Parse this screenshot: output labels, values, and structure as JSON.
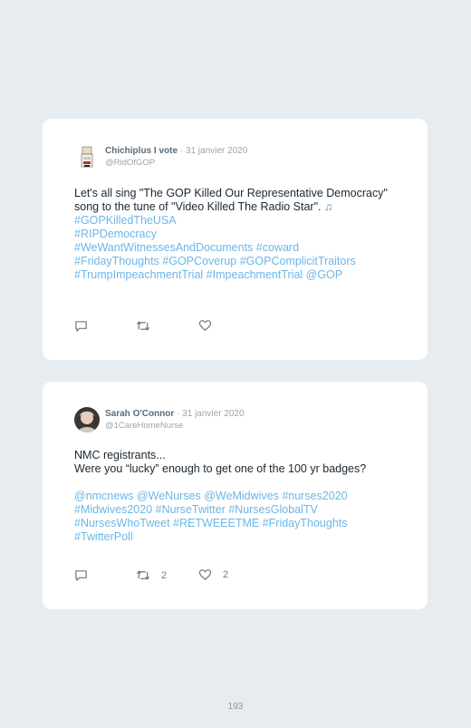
{
  "tweets": [
    {
      "author": "Chichiplus I vote",
      "date": "· 31 janvier 2020",
      "handle": "@RidOfGOP",
      "text": "Let's all sing \"The GOP Killed Our Representative Democracy\" song to the tune of \"Video Killed The Radio Star\".",
      "emoji_icon": "music-notes-icon",
      "tag_lines": [
        "#GOPKilledTheUSA",
        "#RIPDemocracy",
        "#WeWantWitnessesAndDocuments #coward",
        "#FridayThoughts #GOPCoverup #GOPComplicitTraitors",
        "#TrumpImpeachmentTrial #ImpeachmentTrial @GOP"
      ],
      "retweets": "",
      "likes": ""
    },
    {
      "author": "Sarah O'Connor",
      "date": "· 31 janvier 2020",
      "handle": "@1CareHomeNurse",
      "text_lines": [
        "NMC registrants...",
        "Were you “lucky” enough to get one of the 100 yr badges?"
      ],
      "tag_lines": [
        "@nmcnews @WeNurses @WeMidwives #nurses2020",
        "#Midwives2020 #NurseTwitter #NursesGlobalTV",
        "#NursesWhoTweet #RETWEEETME #FridayThoughts",
        "#TwitterPoll"
      ],
      "retweets": "2",
      "likes": "2"
    }
  ],
  "page_number": "193",
  "colors": {
    "background": "#e6ecf0",
    "card": "#ffffff",
    "hashtag": "#6cb6e6",
    "icon": "#6c7a86"
  }
}
